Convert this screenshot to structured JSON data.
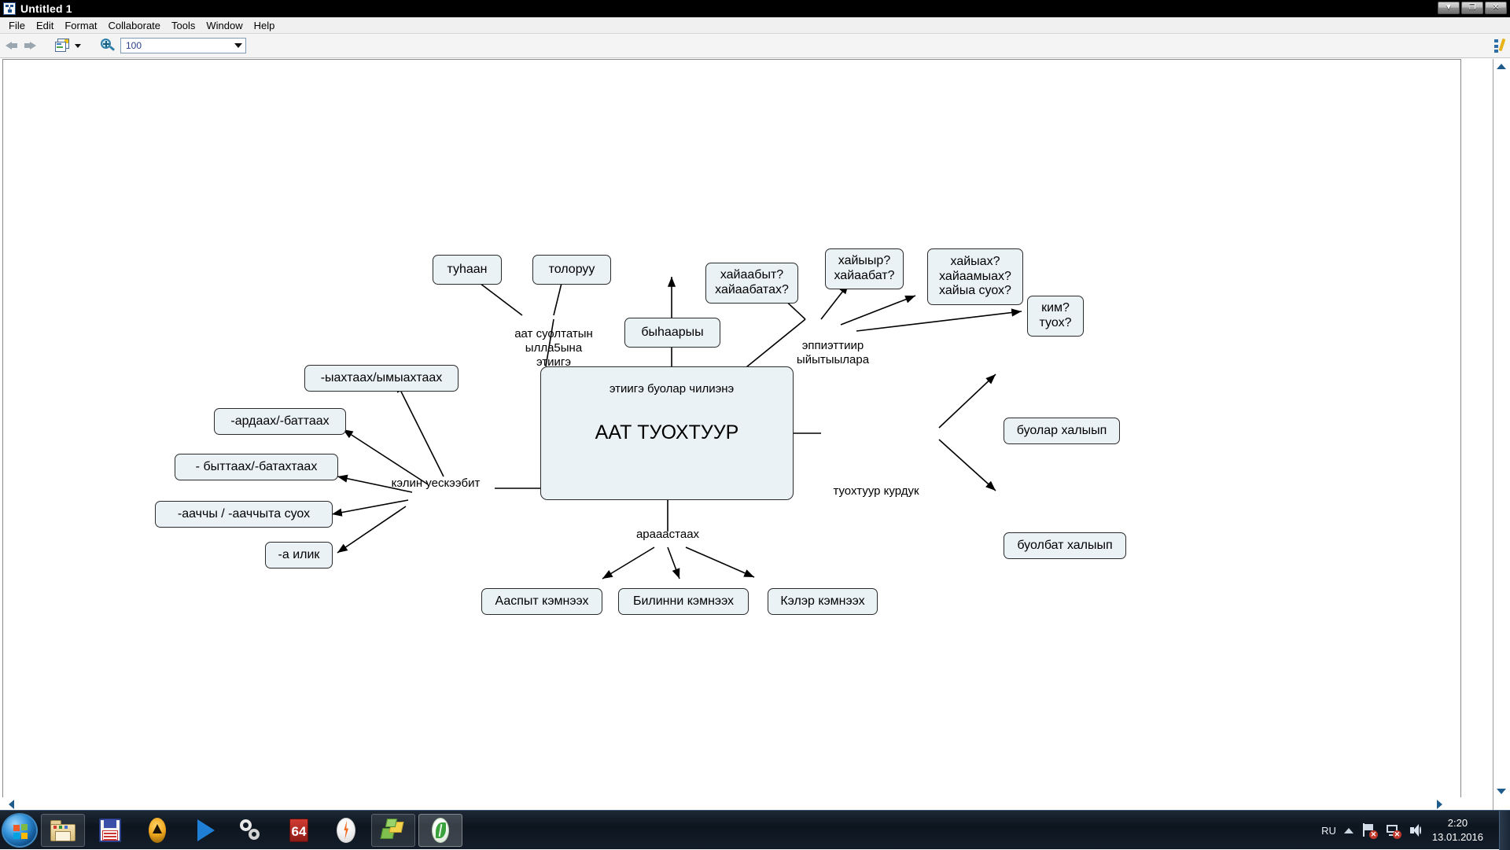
{
  "window": {
    "title": "Untitled 1",
    "app_icon": "mindmap-icon",
    "controls": {
      "minimize": "▼",
      "restore": "❐",
      "close": "✕"
    }
  },
  "menubar": {
    "items": [
      "File",
      "Edit",
      "Format",
      "Collaborate",
      "Tools",
      "Window",
      "Help"
    ]
  },
  "toolbar": {
    "back_icon": "back-arrow-icon",
    "forward_icon": "forward-arrow-icon",
    "document_icon": "new-document-icon",
    "document_dropdown_icon": "chevron-down-icon",
    "zoom_icon": "magnifier-plus-icon",
    "zoom_value": "100",
    "zoom_dropdown_icon": "chevron-down-icon"
  },
  "right_rail": {
    "icons": [
      "diagram-edit-icon",
      "ring-brush-icon",
      "notes-document-icon"
    ]
  },
  "scrollbars": {
    "v_up_icon": "scroll-up-arrow-icon",
    "v_down_icon": "scroll-down-arrow-icon",
    "h_left_icon": "scroll-left-arrow-icon",
    "h_right_icon": "scroll-right-arrow-icon"
  },
  "mindmap": {
    "center": {
      "label": "ААТ ТУОХТУУР"
    },
    "nodes": [
      {
        "id": "tuhaan",
        "label": "туһаан"
      },
      {
        "id": "toloruu",
        "label": "толоруу"
      },
      {
        "id": "byhaaryy",
        "label": "быһаарыы"
      },
      {
        "id": "q_past",
        "label": "хайаабыт?\nхайаабатах?"
      },
      {
        "id": "q_pres",
        "label": "хайыыр?\nхайаабат?"
      },
      {
        "id": "q_fut",
        "label": "хайыах?\nхайаамыах?\nхайыа суох?"
      },
      {
        "id": "q_who",
        "label": "ким?\nтуох?"
      },
      {
        "id": "s_yahtaah",
        "label": "-ыахтаах/ымыахтаах"
      },
      {
        "id": "s_ardaah",
        "label": "-ардаах/-баттаах"
      },
      {
        "id": "s_byttaah",
        "label": "- быттаах/-батахтаах"
      },
      {
        "id": "s_aaччy",
        "label": "-ааччы / -ааччыта суох"
      },
      {
        "id": "s_ailik",
        "label": "-а илик"
      },
      {
        "id": "buolar",
        "label": "буолар халыып"
      },
      {
        "id": "buolbat",
        "label": "буолбат халыып"
      },
      {
        "id": "aaspyt",
        "label": "Ааспыт кэмнээх"
      },
      {
        "id": "bilinni",
        "label": "Билинни кэмнээх"
      },
      {
        "id": "kelэr",
        "label": "Кэлэр кэмнээх"
      }
    ],
    "edge_labels": [
      {
        "id": "l_aat",
        "label": "аат суолтатын\nылла5ына\nэтиигэ"
      },
      {
        "id": "l_etiige",
        "label": "этиигэ буолар чилиэнэ"
      },
      {
        "id": "l_eppi",
        "label": "эппиэттиир\nыйытыылара"
      },
      {
        "id": "l_kelin",
        "label": "кэлин уескээбит"
      },
      {
        "id": "l_tuoh",
        "label": "туохтуур курдук"
      },
      {
        "id": "l_araas",
        "label": "арааастаах"
      }
    ],
    "colors": {
      "node_fill": "#eaf2f6",
      "node_border": "#2b2b2b",
      "edge": "#000000"
    }
  },
  "taskbar": {
    "start_icon": "windows-start-orb-icon",
    "items": [
      {
        "icon": "folder-explorer-icon",
        "state": "pinned"
      },
      {
        "icon": "floppy-save-icon",
        "state": "normal"
      },
      {
        "icon": "amber-triangle-icon",
        "state": "normal"
      },
      {
        "icon": "blue-play-icon",
        "state": "normal"
      },
      {
        "icon": "gears-settings-icon",
        "state": "normal"
      },
      {
        "icon": "sixty-four-icon",
        "label": "64",
        "state": "normal"
      },
      {
        "icon": "orange-bolt-icon",
        "state": "normal"
      },
      {
        "icon": "green-shapes-icon",
        "state": "pinned"
      },
      {
        "icon": "green-leaf-icon",
        "state": "active"
      }
    ],
    "tray": {
      "language": "RU",
      "chevron_icon": "show-hidden-icons-icon",
      "flag_icon": "action-center-flag-icon",
      "network_icon": "network-disconnected-icon",
      "volume_icon": "volume-speaker-icon",
      "time": "2:20",
      "date": "13.01.2016"
    }
  }
}
